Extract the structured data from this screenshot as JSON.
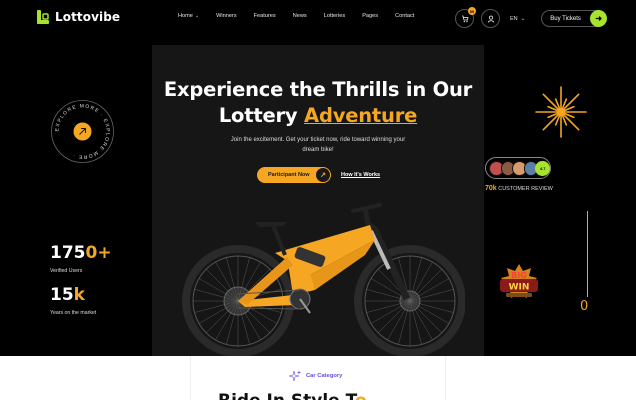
{
  "brand": {
    "name": "Lottovibe"
  },
  "nav": [
    {
      "label": "Home",
      "has_dropdown": true
    },
    {
      "label": "Winners",
      "has_dropdown": false
    },
    {
      "label": "Features",
      "has_dropdown": false
    },
    {
      "label": "News",
      "has_dropdown": false
    },
    {
      "label": "Lotteries",
      "has_dropdown": false
    },
    {
      "label": "Pages",
      "has_dropdown": false
    },
    {
      "label": "Contact",
      "has_dropdown": false
    }
  ],
  "header": {
    "cart_count": "00",
    "language": "EN",
    "buy_tickets_label": "Buy Tickets"
  },
  "hero": {
    "title_line1": "Experience the Thrills in Our",
    "title_line2_plain": "Lottery ",
    "title_line2_highlight": "Adventure",
    "subtitle": "Join the excitement. Get your ticket now, ride toward winning your dream bike!",
    "participate_label": "Participant Now",
    "how_label": "How It's Works"
  },
  "explore_badge": {
    "text": "EXPLORE MORE · EXPLORE MORE · "
  },
  "stats": [
    {
      "number": "175",
      "accent": "0+",
      "label": "Verified Users"
    },
    {
      "number": "15",
      "accent": "k",
      "label": "Years on the market"
    }
  ],
  "review": {
    "avatar_count_label": "4.7",
    "count": "70k",
    "label": "CUSTOMER REVIEW"
  },
  "counter": {
    "value": "0"
  },
  "bigwin": {
    "line1": "BIG",
    "line2": "WIN"
  },
  "category": {
    "label": "Car Category",
    "title_plain": "Ride In Style T",
    "title_accent": "o"
  },
  "colors": {
    "accent": "#f5a623",
    "lime": "#a6e22e",
    "purple": "#6a4cdb"
  }
}
